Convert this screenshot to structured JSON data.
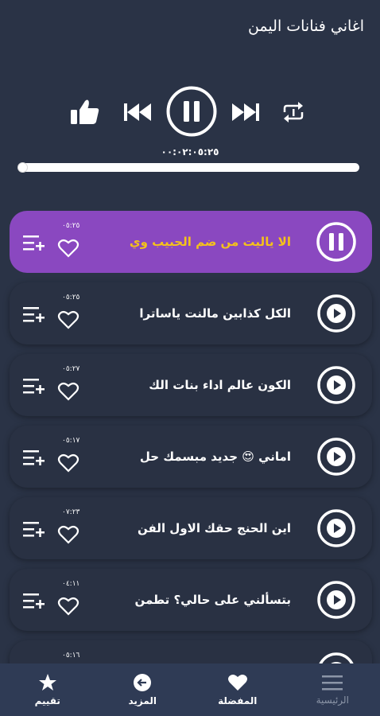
{
  "header": {
    "title": "اغاني فنانات اليمن"
  },
  "player": {
    "time": "٠٠:٠٢:٠٥:٢٥",
    "progress": 0.0,
    "icons": [
      "like-icon",
      "previous-icon",
      "pause-icon",
      "next-icon",
      "repeat-icon"
    ]
  },
  "songs": [
    {
      "name": "الا ياليت من ضم الحبيب وي",
      "duration": "٠٥:٢٥",
      "active": true
    },
    {
      "name": "الكل كذابين مالنت ياساترا",
      "duration": "٠٥:٢٥",
      "active": false
    },
    {
      "name": "الكون عالم  اداء بنات الك",
      "duration": "٠٥:٢٧",
      "active": false
    },
    {
      "name": "اماني 😍 جديد   مبسمك حل",
      "duration": "٠٥:١٧",
      "active": false
    },
    {
      "name": "اين الحنج حقك الاول  الفن",
      "duration": "٠٧:٢٣",
      "active": false
    },
    {
      "name": "بتسألني على حالي؟  تطمن",
      "duration": "٠٤:١١",
      "active": false
    },
    {
      "name": "",
      "duration": "٠٥:١٦",
      "active": false
    }
  ],
  "bottom_nav": {
    "home": "الرئيسية",
    "favorites": "المفضلة",
    "more": "المزيد",
    "rate": "تقييم"
  },
  "colors": {
    "background": "#2a3346",
    "active_row": "#8a48c0",
    "active_title": "#f5c21a",
    "bottom_bar": "#2f3b55"
  }
}
